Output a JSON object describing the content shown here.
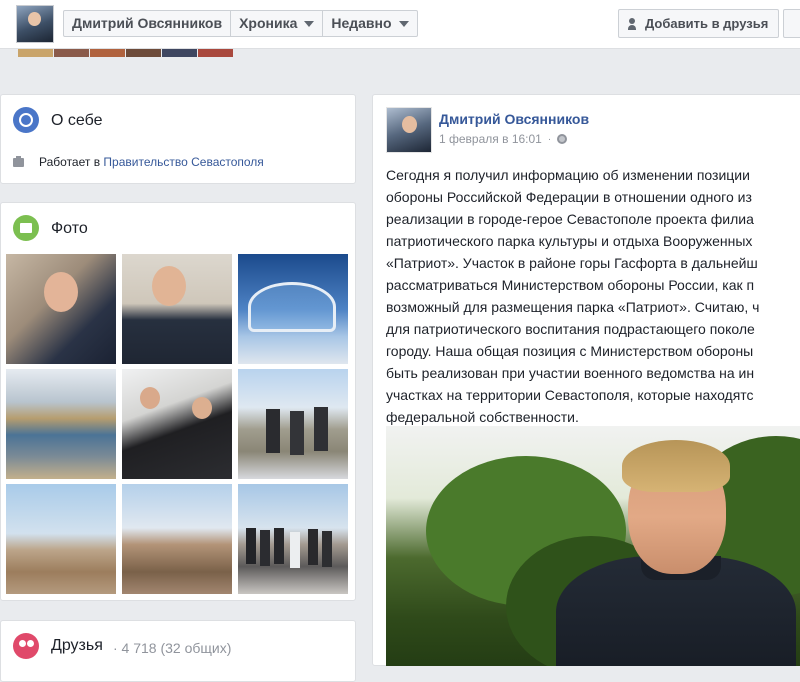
{
  "header": {
    "profile_name": "Дмитрий Овсянников",
    "tabs": [
      {
        "label": "Хроника"
      },
      {
        "label": "Недавно"
      }
    ],
    "add_friend_label": "Добавить в друзья"
  },
  "about": {
    "title": "О себе",
    "work_prefix": "Работает в",
    "work_link": "Правительство Севастополя"
  },
  "photos": {
    "title": "Фото",
    "items": [
      {
        "icon": "portrait-photo"
      },
      {
        "icon": "portrait-photo"
      },
      {
        "icon": "building-photo"
      },
      {
        "icon": "coast-photo"
      },
      {
        "icon": "meeting-photo"
      },
      {
        "icon": "walk-photo"
      },
      {
        "icon": "construction-photo"
      },
      {
        "icon": "trench-photo"
      },
      {
        "icon": "group-photo"
      }
    ]
  },
  "friends": {
    "title": "Друзья",
    "count": "· 4 718 (32 общих)"
  },
  "post": {
    "author": "Дмитрий Овсянников",
    "date": "1 февраля в 16:01",
    "separator": "·",
    "lines": [
      "Сегодня я получил информацию об изменении позиции",
      "обороны Российской Федерации в отношении одного из",
      "реализации в городе-герое Севастополе проекта филиа",
      "патриотического парка культуры и отдыха Вооруженных",
      "«Патриот». Участок в районе горы Гасфорта в дальнейш",
      "рассматриваться Министерством обороны России, как п",
      "возможный для размещения парка «Патриот». Считаю, ч",
      "для патриотического воспитания подрастающего поколе",
      "городу. Наша общая позиция с Министерством обороны",
      "быть реализован при участии военного ведомства на ин",
      "участках на территории Севастополя, которые находятс",
      "федеральной собственности."
    ]
  },
  "colors": {
    "link": "#365899",
    "background": "#e9ebee",
    "muted": "#90949c"
  }
}
